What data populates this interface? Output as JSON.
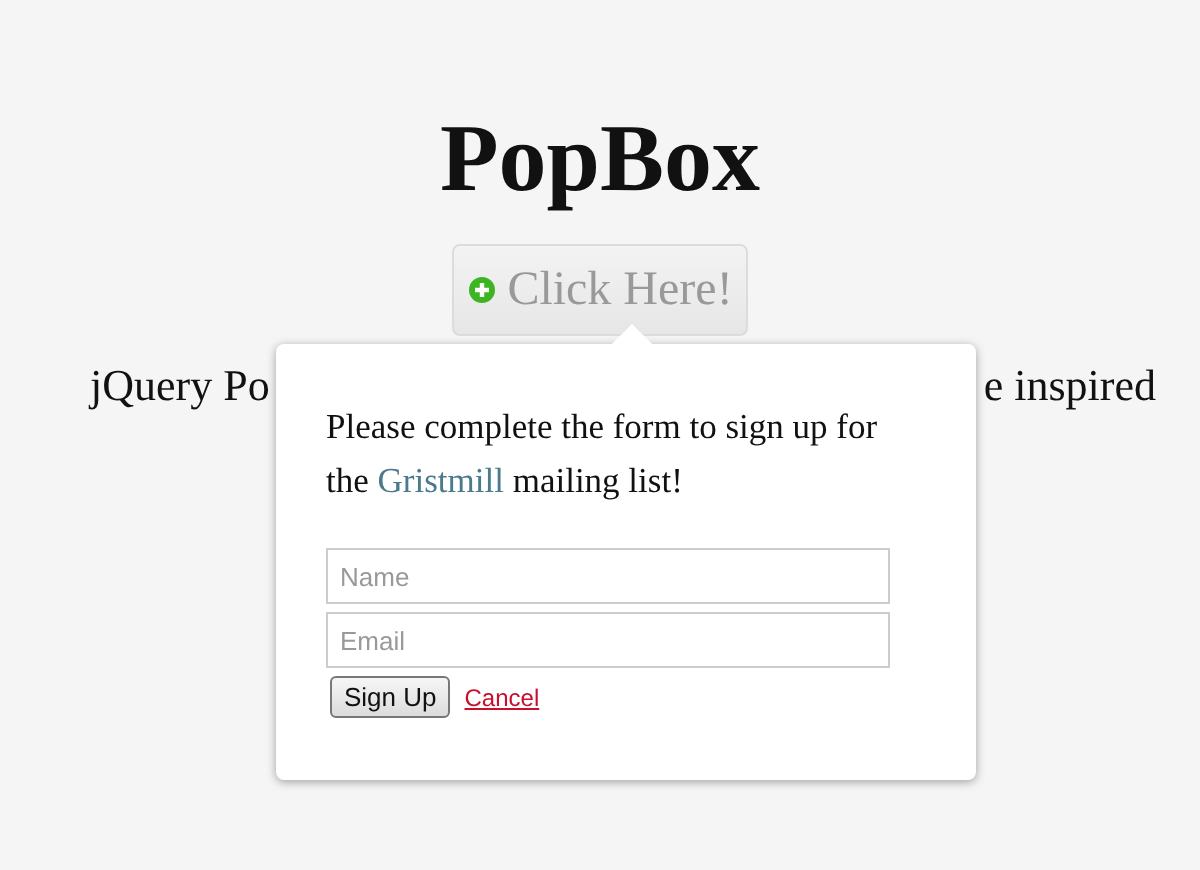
{
  "title": "PopBox",
  "open_button": {
    "label": "Click Here!"
  },
  "paragraph_fragments": [
    "jQuery Po",
    "e inspired"
  ],
  "popup": {
    "message_before": "Please complete the form to sign up for the",
    "link": "Gristmill",
    "message_after": "mailing list!",
    "fields": [
      {
        "placeholder": "Name"
      },
      {
        "placeholder": "Email"
      }
    ],
    "submit": "Sign Up",
    "cancel": "Cancel"
  }
}
